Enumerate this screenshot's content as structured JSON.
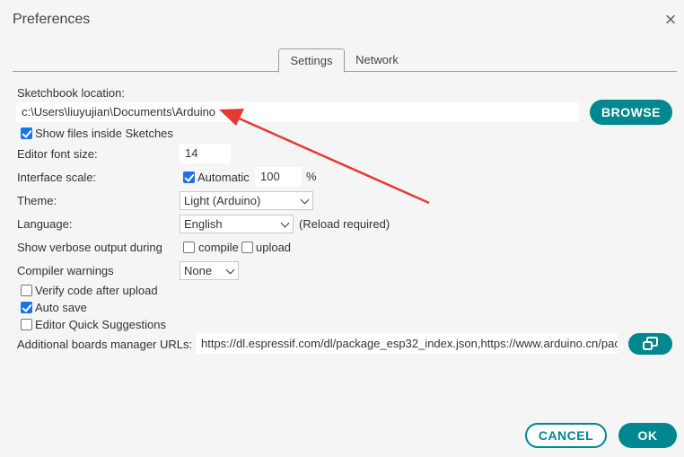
{
  "dialog": {
    "title": "Preferences"
  },
  "tabs": [
    "Settings",
    "Network"
  ],
  "sketchbook": {
    "label": "Sketchbook location:",
    "path": "c:\\Users\\liuyujian\\Documents\\Arduino",
    "browse_label": "BROWSE"
  },
  "show_files": {
    "label": "Show files inside Sketches",
    "checked": true
  },
  "editor_font": {
    "label": "Editor font size:",
    "value": "14"
  },
  "interface_scale": {
    "label": "Interface scale:",
    "automatic_label": "Automatic",
    "automatic_checked": true,
    "value": "100",
    "unit": "%"
  },
  "theme": {
    "label": "Theme:",
    "value": "Light (Arduino)"
  },
  "language": {
    "label": "Language:",
    "value": "English",
    "note": "(Reload required)"
  },
  "verbose": {
    "label": "Show verbose output during",
    "compile_label": "compile",
    "upload_label": "upload"
  },
  "compiler_warnings": {
    "label": "Compiler warnings",
    "value": "None"
  },
  "verify": {
    "label": "Verify code after upload",
    "checked": false
  },
  "auto_save": {
    "label": "Auto save",
    "checked": true
  },
  "quick_suggestions": {
    "label": "Editor Quick Suggestions",
    "checked": false
  },
  "boards_urls": {
    "label": "Additional boards manager URLs:",
    "value": "https://dl.espressif.com/dl/package_esp32_index.json,https://www.arduino.cn/package_index.json"
  },
  "footer": {
    "cancel_label": "CANCEL",
    "ok_label": "OK"
  },
  "colors": {
    "accent": "#00878f",
    "checkbox": "#1a73e8",
    "arrow": "#e53935"
  },
  "icons": {
    "close": "close-icon",
    "open_window": "open-window-icon"
  }
}
